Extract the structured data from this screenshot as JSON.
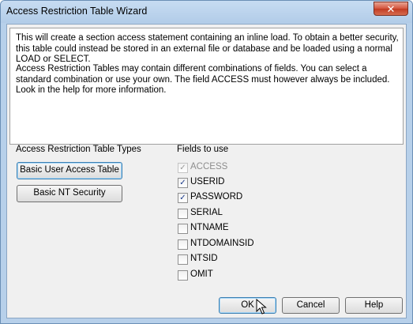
{
  "window": {
    "title": "Access Restriction Table Wizard",
    "close_glyph": "✕"
  },
  "info": {
    "paragraph1": "This will create a section access statement containing an inline load. To obtain a better security, this table could instead be stored in an external file or database and be loaded using a normal LOAD or SELECT.",
    "paragraph2": "Access Restriction Tables may contain different combinations of fields. You can select a standard combination or use your own. The field ACCESS must however always be included. Look in the help for more information."
  },
  "types": {
    "label": "Access Restriction Table Types",
    "buttons": [
      "Basic User Access Table",
      "Basic NT Security"
    ]
  },
  "fields": {
    "label": "Fields to use",
    "items": [
      {
        "label": "ACCESS",
        "checked": true,
        "disabled": true
      },
      {
        "label": "USERID",
        "checked": true,
        "disabled": false
      },
      {
        "label": "PASSWORD",
        "checked": true,
        "disabled": false
      },
      {
        "label": "SERIAL",
        "checked": false,
        "disabled": false
      },
      {
        "label": "NTNAME",
        "checked": false,
        "disabled": false
      },
      {
        "label": "NTDOMAINSID",
        "checked": false,
        "disabled": false
      },
      {
        "label": "NTSID",
        "checked": false,
        "disabled": false
      },
      {
        "label": "OMIT",
        "checked": false,
        "disabled": false
      }
    ]
  },
  "footer": {
    "ok_label": "OK",
    "cancel_label": "Cancel",
    "help_label": "Help"
  },
  "check_glyph": "✓"
}
